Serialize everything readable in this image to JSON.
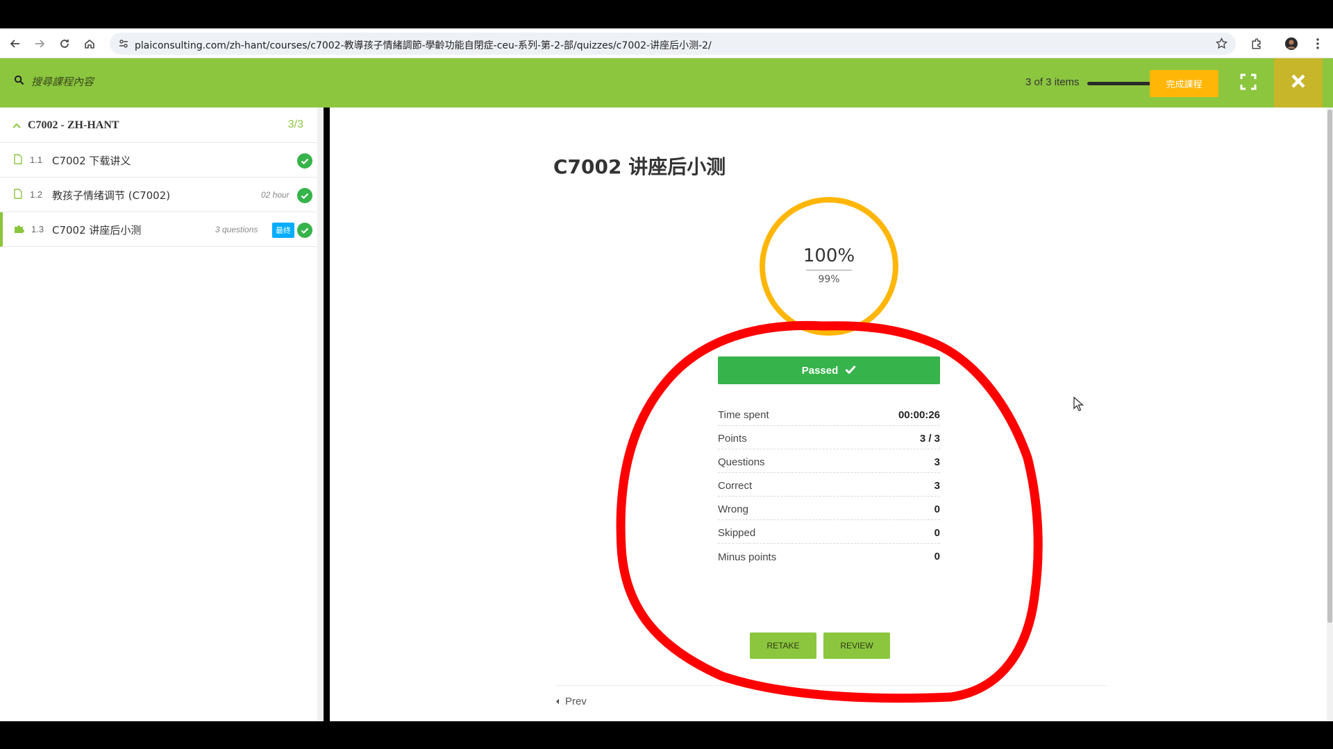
{
  "browser": {
    "url": "plaiconsulting.com/zh-hant/courses/c7002-教導孩子情緒調節-學齡功能自閉症-ceu-系列-第-2-部/quizzes/c7002-讲座后小测-2/"
  },
  "header": {
    "search_placeholder": "搜尋課程內容",
    "items_count": "3 of 3 items",
    "progress": 1.0,
    "finish_label": "完成課程",
    "accent_color": "#8cc63f",
    "finish_color": "#ffb606"
  },
  "sidebar": {
    "section_title": "C7002 - ZH-HANT",
    "section_count": "3/3",
    "lessons": [
      {
        "num": "1.1",
        "title": "C7002 下载讲义",
        "meta": "",
        "badge": "",
        "icon": "document-icon"
      },
      {
        "num": "1.2",
        "title": "教孩子情绪调节 (C7002)",
        "meta": "02 hour",
        "badge": "",
        "icon": "document-icon"
      },
      {
        "num": "1.3",
        "title": "C7002 讲座后小测",
        "meta": "3 questions",
        "badge": "最终",
        "icon": "puzzle-icon"
      }
    ]
  },
  "quiz": {
    "title": "C7002 讲座后小测",
    "score": "100%",
    "passing": "99%",
    "status": "Passed",
    "stats": [
      {
        "label": "Time spent",
        "value": "00:00:26"
      },
      {
        "label": "Points",
        "value": "3 / 3"
      },
      {
        "label": "Questions",
        "value": "3"
      },
      {
        "label": "Correct",
        "value": "3"
      },
      {
        "label": "Wrong",
        "value": "0"
      },
      {
        "label": "Skipped",
        "value": "0"
      },
      {
        "label": "Minus points",
        "value": "0"
      }
    ],
    "retake_label": "RETAKE",
    "review_label": "REVIEW",
    "prev_label": "Prev"
  }
}
